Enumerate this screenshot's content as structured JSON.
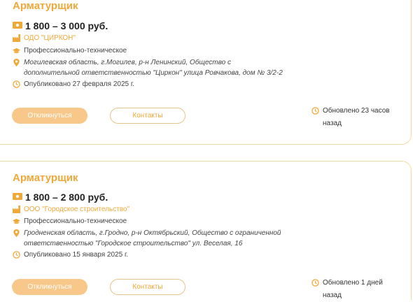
{
  "vacancies": [
    {
      "title": "Арматурщик",
      "salary": "1 800 – 3 000 руб.",
      "company": "ОДО \"ЦИРКОН\"",
      "education": "Профессионально-техническое",
      "address": "Могилевская область, г.Могилев, р-н Ленинский, Общество с дополнительной ответственностью \"Циркон\" улица Ровчакова, дом № 3/2-2",
      "published": "Опубликовано 27 февраля 2025 г.",
      "respond_label": "Откликнуться",
      "contacts_label": "Контакты",
      "updated": "Обновлено 23 часов назад"
    },
    {
      "title": "Арматурщик",
      "salary": "1 800 – 2 800 руб.",
      "company": "ООО \"Городское строительство\"",
      "education": "Профессионально-техническое",
      "address": "Гродненская область, г.Гродно, р-н Октябрьский, Общество с ограниченной ответственностью \"Городское строительство\" ул. Веселая, 16",
      "published": "Опубликовано 15 января 2025 г.",
      "respond_label": "Откликнуться",
      "contacts_label": "Контакты",
      "updated": "Обновлено 1 дней назад"
    }
  ],
  "colors": {
    "accent": "#f0a838",
    "button_fill": "#f8c88a",
    "border": "#f3d9a6"
  }
}
